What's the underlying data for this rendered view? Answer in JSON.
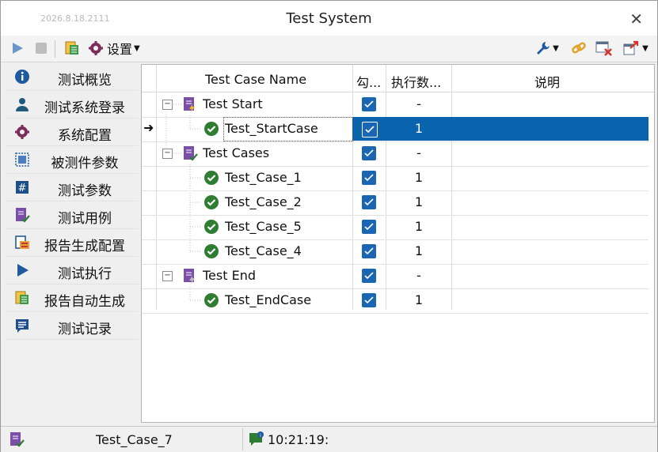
{
  "window": {
    "title": "Test System",
    "build": "2026.8.18.2111"
  },
  "toolbar": {
    "settings_label": "设置"
  },
  "sidebar": {
    "items": [
      {
        "label": "测试概览",
        "icon": "info-icon"
      },
      {
        "label": "测试系统登录",
        "icon": "user-icon"
      },
      {
        "label": "系统配置",
        "icon": "gear-icon"
      },
      {
        "label": "被测件参数",
        "icon": "component-icon"
      },
      {
        "label": "测试参数",
        "icon": "hash-icon"
      },
      {
        "label": "测试用例",
        "icon": "test-case-icon"
      },
      {
        "label": "报告生成配置",
        "icon": "report-config-icon"
      },
      {
        "label": "测试执行",
        "icon": "play-icon"
      },
      {
        "label": "报告自动生成",
        "icon": "report-generate-icon"
      },
      {
        "label": "测试记录",
        "icon": "log-icon"
      }
    ]
  },
  "grid": {
    "columns": {
      "name": "Test Case Name",
      "check": "勾...",
      "count": "执行数...",
      "desc": "说明"
    },
    "rows": [
      {
        "name": "Test Start",
        "count": "-",
        "level": 0,
        "checked": true
      },
      {
        "name": "Test_StartCase",
        "count": "1",
        "level": 1,
        "checked": true,
        "selected": true
      },
      {
        "name": "Test Cases",
        "count": "-",
        "level": 0,
        "checked": true
      },
      {
        "name": "Test_Case_1",
        "count": "1",
        "level": 1,
        "checked": true
      },
      {
        "name": "Test_Case_2",
        "count": "1",
        "level": 1,
        "checked": true
      },
      {
        "name": "Test_Case_5",
        "count": "1",
        "level": 1,
        "checked": true
      },
      {
        "name": "Test_Case_4",
        "count": "1",
        "level": 1,
        "checked": true
      },
      {
        "name": "Test End",
        "count": "-",
        "level": 0,
        "checked": true
      },
      {
        "name": "Test_EndCase",
        "count": "1",
        "level": 1,
        "checked": true
      }
    ]
  },
  "status": {
    "current_case": "Test_Case_7",
    "time": "10:21:19:"
  },
  "colors": {
    "accent": "#0a64ad",
    "checkbox": "#1a66b3",
    "success": "#2e7d32",
    "group_icon": "#7b4fa8"
  }
}
